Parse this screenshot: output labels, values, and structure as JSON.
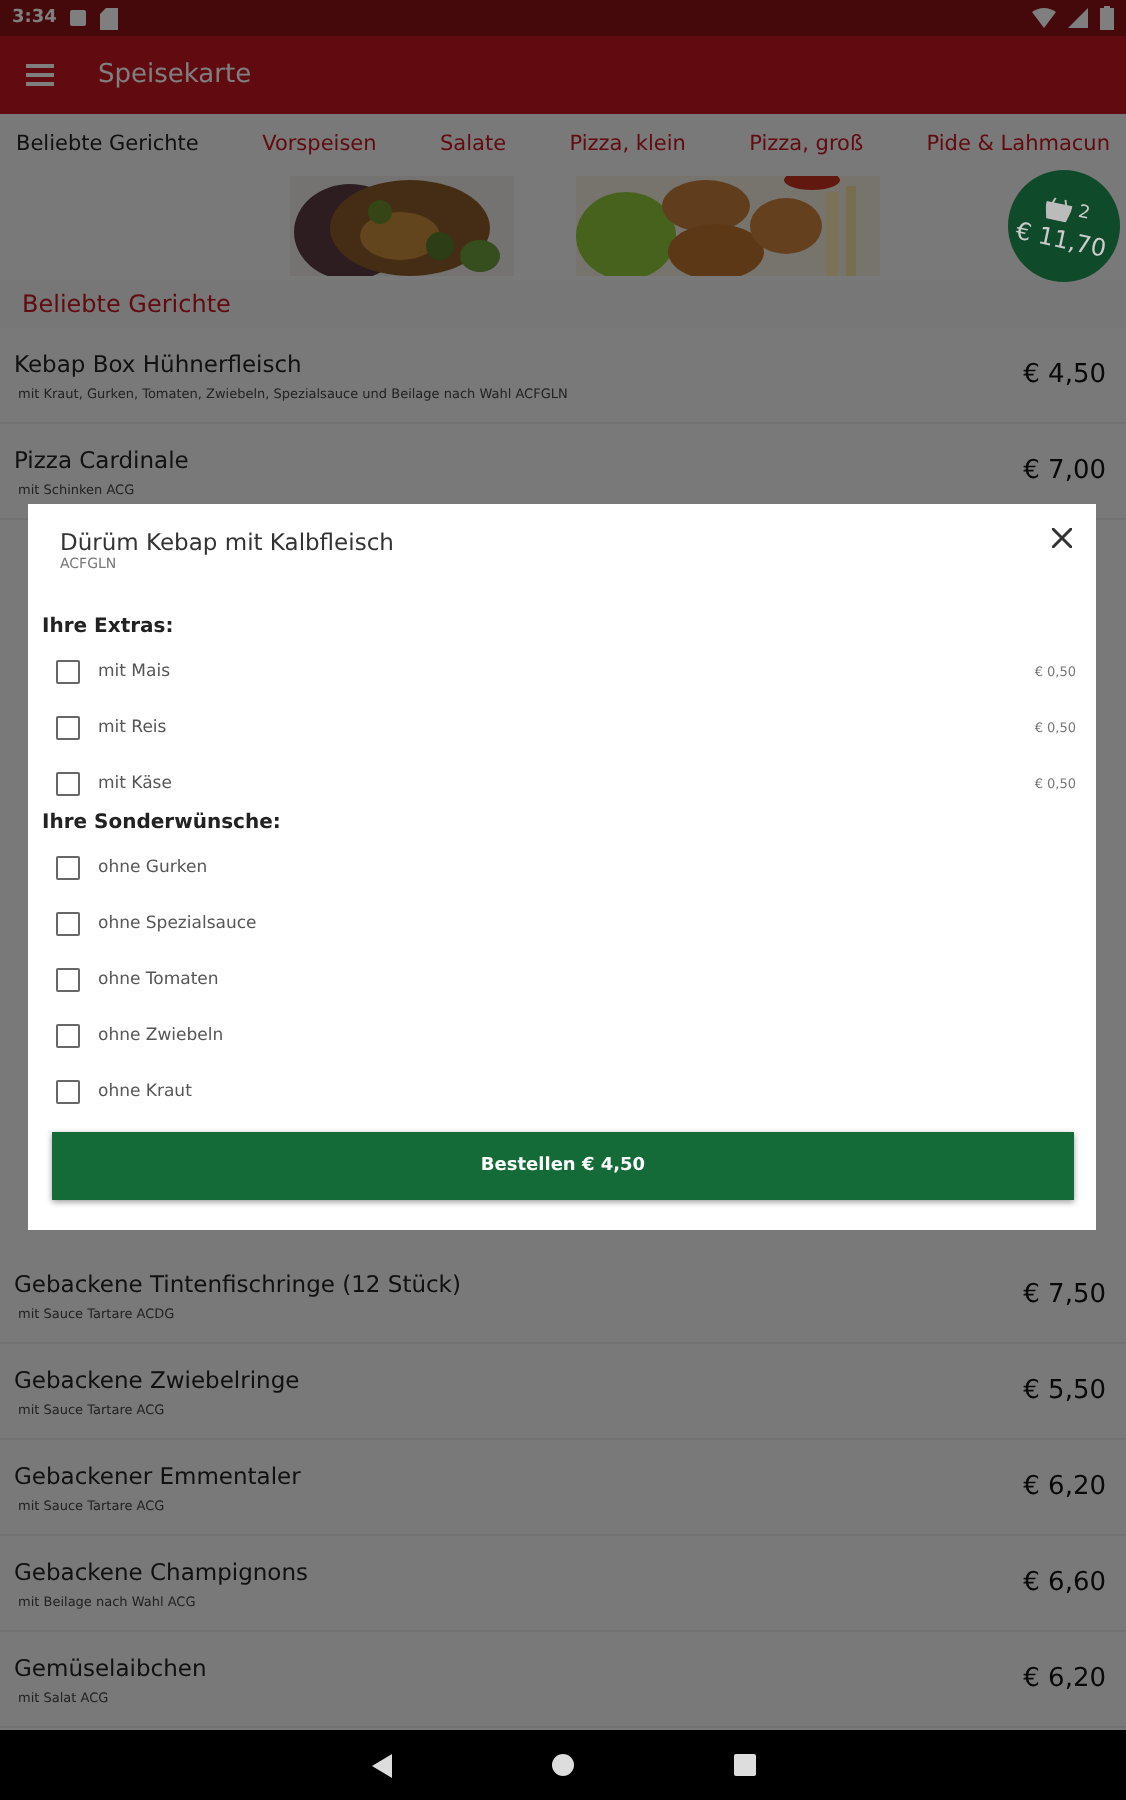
{
  "status_bar": {
    "time": "3:34"
  },
  "app_bar": {
    "title": "Speisekarte"
  },
  "tabs": [
    {
      "label": "Beliebte Gerichte",
      "selected": true
    },
    {
      "label": "Vorspeisen",
      "selected": false
    },
    {
      "label": "Salate",
      "selected": false
    },
    {
      "label": "Pizza, klein",
      "selected": false
    },
    {
      "label": "Pizza, groß",
      "selected": false
    },
    {
      "label": "Pide & Lahmacun",
      "selected": false
    }
  ],
  "cart": {
    "count": "2",
    "total": "€ 11,70"
  },
  "section_title": "Beliebte Gerichte",
  "items_top": [
    {
      "name": "Kebap Box Hühnerfleisch",
      "description": "mit Kraut, Gurken, Tomaten, Zwiebeln, Spezialsauce und Beilage nach Wahl ACFGLN",
      "price": "€ 4,50"
    },
    {
      "name": "Pizza Cardinale",
      "description": "mit Schinken ACG",
      "price": "€ 7,00"
    }
  ],
  "items_bottom": [
    {
      "name": "Gebackene Tintenfischringe (12 Stück)",
      "description": "mit Sauce Tartare ACDG",
      "price": "€ 7,50"
    },
    {
      "name": "Gebackene Zwiebelringe",
      "description": "mit Sauce Tartare ACG",
      "price": "€ 5,50"
    },
    {
      "name": "Gebackener Emmentaler",
      "description": "mit Sauce Tartare ACG",
      "price": "€ 6,20"
    },
    {
      "name": "Gebackene Champignons",
      "description": "mit Beilage nach Wahl ACG",
      "price": "€ 6,60"
    },
    {
      "name": "Gemüselaibchen",
      "description": "mit Salat ACG",
      "price": "€ 6,20"
    }
  ],
  "dialog": {
    "title": "Dürüm Kebap mit Kalbfleisch",
    "allergens": "ACFGLN",
    "groups": [
      {
        "heading": "Ihre Extras:",
        "options": [
          {
            "label": "mit Mais",
            "price": "€ 0,50",
            "checked": false
          },
          {
            "label": "mit Reis",
            "price": "€ 0,50",
            "checked": false
          },
          {
            "label": "mit Käse",
            "price": "€ 0,50",
            "checked": false
          }
        ]
      },
      {
        "heading": "Ihre Sonderwünsche:",
        "options": [
          {
            "label": "ohne Gurken",
            "checked": false
          },
          {
            "label": "ohne Spezialsauce",
            "checked": false
          },
          {
            "label": "ohne Tomaten",
            "checked": false
          },
          {
            "label": "ohne Zwiebeln",
            "checked": false
          },
          {
            "label": "ohne Kraut",
            "checked": false
          }
        ]
      }
    ],
    "order_button": "Bestellen € 4,50"
  }
}
